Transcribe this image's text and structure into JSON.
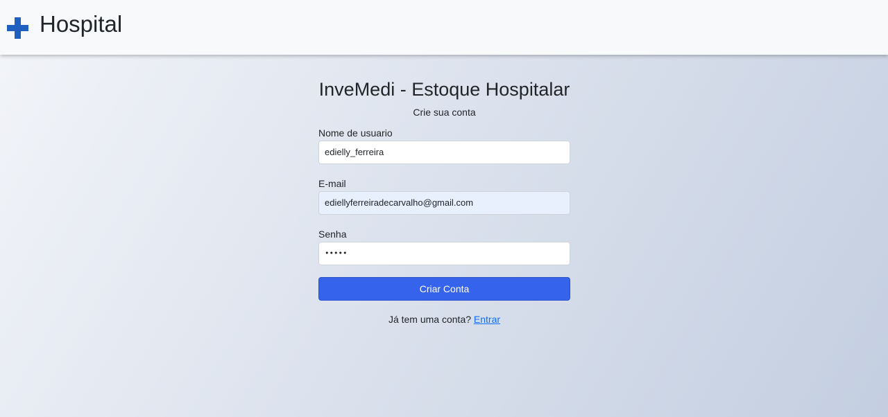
{
  "header": {
    "brand": "Hospital",
    "logo_icon": "medical-cross-icon",
    "logo_color": "#1f5fbf"
  },
  "form": {
    "title": "InveMedi - Estoque Hospitalar",
    "subtitle": "Crie sua conta",
    "username": {
      "label": "Nome de usuario",
      "value": "edielly_ferreira"
    },
    "email": {
      "label": "E-mail",
      "value": "ediellyferreiradecarvalho@gmail.com"
    },
    "password": {
      "label": "Senha",
      "value": "•••••"
    },
    "submit_label": "Criar Conta",
    "login_prompt": "Já tem uma conta?",
    "login_link": "Entrar"
  },
  "colors": {
    "accent": "#3563eb",
    "link": "#0d6efd",
    "autofill_bg": "#e8f0fe"
  }
}
